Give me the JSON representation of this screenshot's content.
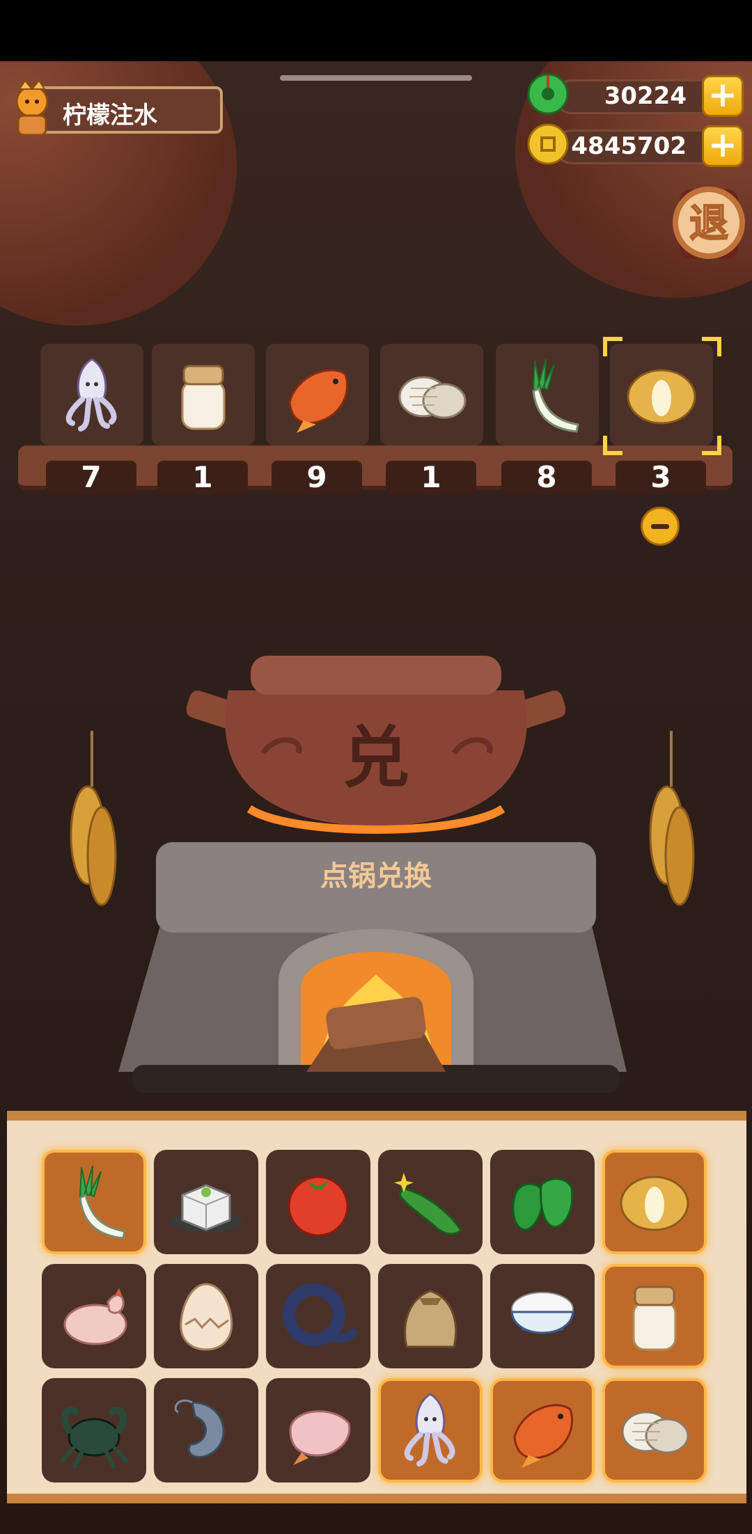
{
  "header": {
    "player_name": "柠檬注水",
    "jade_amount": "30224",
    "coin_amount": "4845702",
    "exit_label": "退"
  },
  "selected_slots": [
    {
      "icon": "squid-icon",
      "count": "7"
    },
    {
      "icon": "milk-jar-icon",
      "count": "1"
    },
    {
      "icon": "carp-fish-icon",
      "count": "9"
    },
    {
      "icon": "clam-icon",
      "count": "1"
    },
    {
      "icon": "scallion-icon",
      "count": "8"
    },
    {
      "icon": "potato-icon",
      "count": "3"
    }
  ],
  "pot": {
    "character": "兑",
    "label": "点锅兑换"
  },
  "inventory": [
    {
      "icon": "scallion-icon",
      "selected": true
    },
    {
      "icon": "tofu-icon",
      "selected": false
    },
    {
      "icon": "tomato-icon",
      "selected": false
    },
    {
      "icon": "cucumber-icon",
      "selected": false
    },
    {
      "icon": "green-pepper-icon",
      "selected": false
    },
    {
      "icon": "potato-icon",
      "selected": true
    },
    {
      "icon": "chicken-icon",
      "selected": false
    },
    {
      "icon": "egg-icon",
      "selected": false
    },
    {
      "icon": "eel-icon",
      "selected": false
    },
    {
      "icon": "flour-sack-icon",
      "selected": false
    },
    {
      "icon": "rice-bowl-icon",
      "selected": false
    },
    {
      "icon": "milk-jar-icon",
      "selected": true
    },
    {
      "icon": "crab-icon",
      "selected": false
    },
    {
      "icon": "shrimp-icon",
      "selected": false
    },
    {
      "icon": "duck-icon",
      "selected": false
    },
    {
      "icon": "squid-icon",
      "selected": true
    },
    {
      "icon": "carp-fish-icon",
      "selected": true
    },
    {
      "icon": "clam-icon",
      "selected": true
    }
  ],
  "colors": {
    "highlight": "#ffb84a",
    "slot_bg": "#4b3128",
    "panel_bg": "#f0dcc0"
  }
}
